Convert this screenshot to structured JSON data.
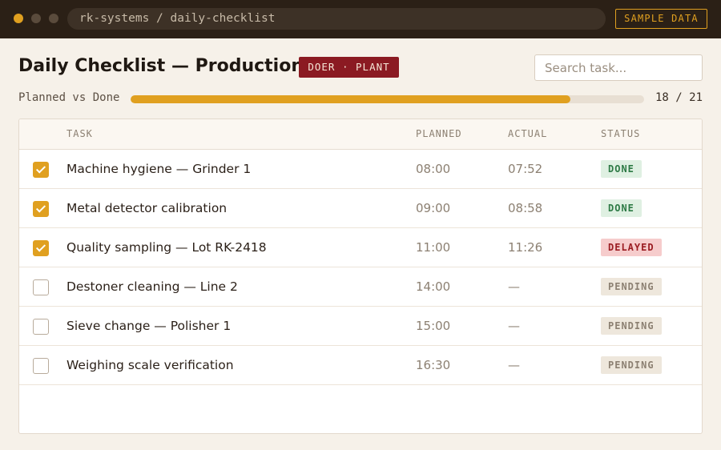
{
  "topbar": {
    "path": "rk-systems / daily-checklist",
    "sample_label": "SAMPLE DATA"
  },
  "header": {
    "title": "Daily Checklist — Production",
    "role_badge": "DOER · PLANT"
  },
  "search": {
    "placeholder": "Search task...",
    "value": ""
  },
  "progress": {
    "label": "Planned vs Done",
    "count": "18 / 21",
    "fraction": 0.857
  },
  "table": {
    "columns": {
      "task": "TASK",
      "planned": "PLANNED",
      "actual": "ACTUAL",
      "status": "STATUS"
    },
    "rows": [
      {
        "checked": true,
        "task": "Machine hygiene — Grinder 1",
        "planned": "08:00",
        "actual": "07:52",
        "status": "DONE",
        "kind": "done"
      },
      {
        "checked": true,
        "task": "Metal detector calibration",
        "planned": "09:00",
        "actual": "08:58",
        "status": "DONE",
        "kind": "done"
      },
      {
        "checked": true,
        "task": "Quality sampling — Lot RK-2418",
        "planned": "11:00",
        "actual": "11:26",
        "status": "DELAYED",
        "kind": "delayed"
      },
      {
        "checked": false,
        "task": "Destoner cleaning — Line 2",
        "planned": "14:00",
        "actual": "—",
        "status": "PENDING",
        "kind": "pending"
      },
      {
        "checked": false,
        "task": "Sieve change — Polisher 1",
        "planned": "15:00",
        "actual": "—",
        "status": "PENDING",
        "kind": "pending"
      },
      {
        "checked": false,
        "task": "Weighing scale verification",
        "planned": "16:30",
        "actual": "—",
        "status": "PENDING",
        "kind": "pending"
      }
    ]
  },
  "colors": {
    "accent": "#e0a020",
    "topbar": "#2b2016",
    "badge": "#8b1a22",
    "done": "#2d7a45",
    "delayed": "#9b1c22"
  }
}
